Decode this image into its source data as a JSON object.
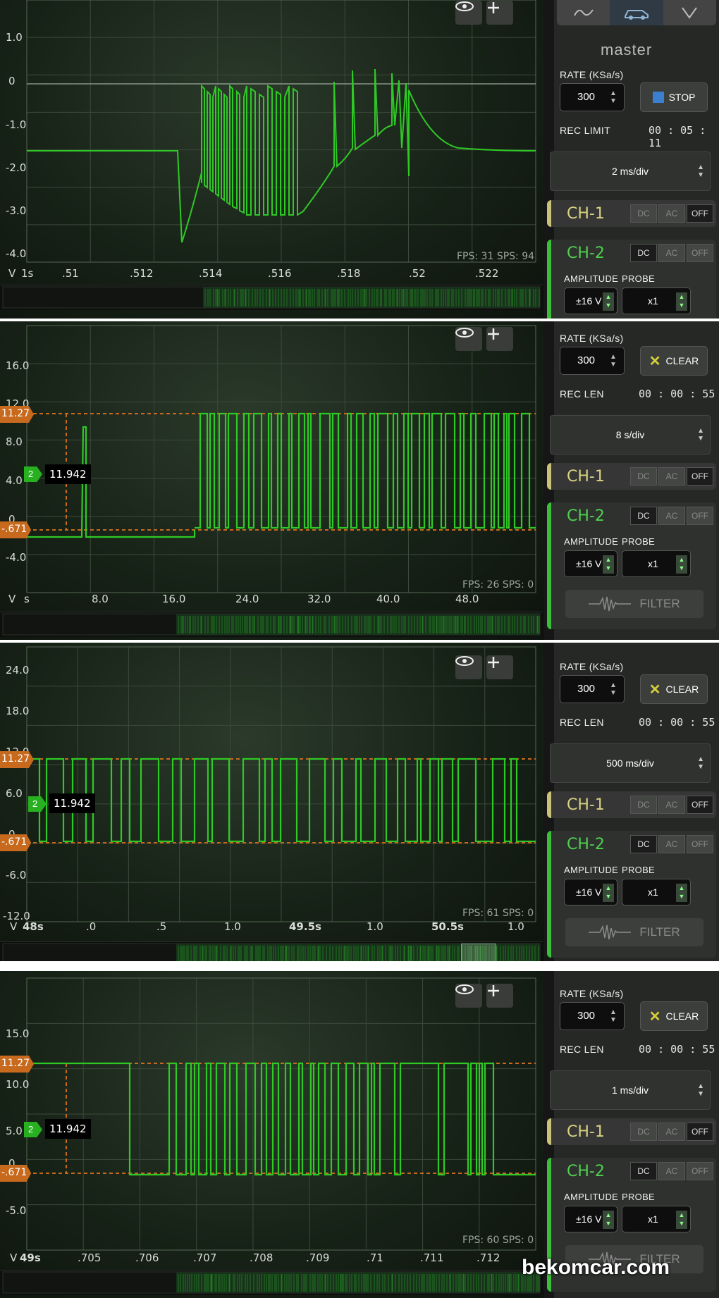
{
  "brand": {
    "watermark": "bekomcar.com"
  },
  "colors": {
    "trace": "#2fc925",
    "marker": "#c86a1e",
    "ch2": "#3bbf3b",
    "ch1": "#c9c37a"
  },
  "panels": [
    {
      "fps": "FPS: 31  SPS: 94",
      "y_ticks": [
        "1.0",
        "0",
        "-1.0",
        "-2.0",
        "-3.0",
        "-4.0"
      ],
      "x_ticks": [
        "V",
        "1s",
        ".51",
        ".512",
        ".514",
        ".516",
        ".518",
        ".52",
        ".522"
      ],
      "sidebar": {
        "mode_tabs": [
          "waveform-icon",
          "car-icon",
          "chevron-down-icon"
        ],
        "master": "master",
        "rate_label": "RATE (KSa/s)",
        "rate_value": "300",
        "action_label": "STOP",
        "rec_label": "REC LIMIT",
        "rec_time": "00 : 05 : 11",
        "timebase": "2 ms/div",
        "ch1": "CH-1",
        "ch2": "CH-2",
        "coupling": [
          "DC",
          "AC",
          "OFF"
        ],
        "amplitude_label": "AMPLITUDE",
        "probe_label": "PROBE",
        "amplitude": "±16 V",
        "probe": "x1"
      }
    },
    {
      "fps": "FPS: 26  SPS: 0",
      "y_ticks": [
        "16.0",
        "12.0",
        "8.0",
        "4.0",
        "0",
        "-4.0"
      ],
      "x_ticks": [
        "V",
        "s",
        "8.0",
        "16.0",
        "24.0",
        "32.0",
        "40.0",
        "48.0"
      ],
      "cursor_high": "11.27",
      "cursor_low": "-.671",
      "ch_marker": "2",
      "value": "11.942",
      "sidebar": {
        "rate_label": "RATE (KSa/s)",
        "rate_value": "300",
        "action_label": "CLEAR",
        "rec_label": "REC LEN",
        "rec_time": "00 : 00 : 55",
        "timebase": "8 s/div",
        "ch1": "CH-1",
        "ch2": "CH-2",
        "coupling": [
          "DC",
          "AC",
          "OFF"
        ],
        "amplitude_label": "AMPLITUDE",
        "probe_label": "PROBE",
        "amplitude": "±16 V",
        "probe": "x1",
        "filter": "FILTER"
      }
    },
    {
      "fps": "FPS: 61  SPS: 0",
      "y_ticks": [
        "24.0",
        "18.0",
        "12.0",
        "6.0",
        "0",
        "-6.0",
        "-12.0"
      ],
      "x_ticks": [
        "V",
        "48s",
        ".0",
        ".5",
        "1.0",
        "49.5s",
        "1.0",
        "50.5s",
        "1.0"
      ],
      "cursor_high": "11.27",
      "cursor_low": "-.671",
      "ch_marker": "2",
      "value": "11.942",
      "sidebar": {
        "rate_label": "RATE (KSa/s)",
        "rate_value": "300",
        "action_label": "CLEAR",
        "rec_label": "REC LEN",
        "rec_time": "00 : 00 : 55",
        "timebase": "500 ms/div",
        "ch1": "CH-1",
        "ch2": "CH-2",
        "coupling": [
          "DC",
          "AC",
          "OFF"
        ],
        "amplitude_label": "AMPLITUDE",
        "probe_label": "PROBE",
        "amplitude": "±16 V",
        "probe": "x1",
        "filter": "FILTER"
      }
    },
    {
      "fps": "FPS: 60  SPS: 0",
      "y_ticks": [
        "15.0",
        "10.0",
        "5.0",
        "0",
        "-5.0"
      ],
      "x_ticks": [
        "V",
        "49s",
        ".705",
        ".706",
        ".707",
        ".708",
        ".709",
        ".71",
        ".711",
        ".712"
      ],
      "cursor_high": "11.27",
      "cursor_low": "-.671",
      "ch_marker": "2",
      "value": "11.942",
      "sidebar": {
        "rate_label": "RATE (KSa/s)",
        "rate_value": "300",
        "action_label": "CLEAR",
        "rec_label": "REC LEN",
        "rec_time": "00 : 00 : 55",
        "timebase": "1 ms/div",
        "ch1": "CH-1",
        "ch2": "CH-2",
        "coupling": [
          "DC",
          "AC",
          "OFF"
        ],
        "amplitude_label": "AMPLITUDE",
        "probe_label": "PROBE",
        "amplitude": "±16 V",
        "probe": "x1",
        "filter": "FILTER"
      }
    }
  ]
}
